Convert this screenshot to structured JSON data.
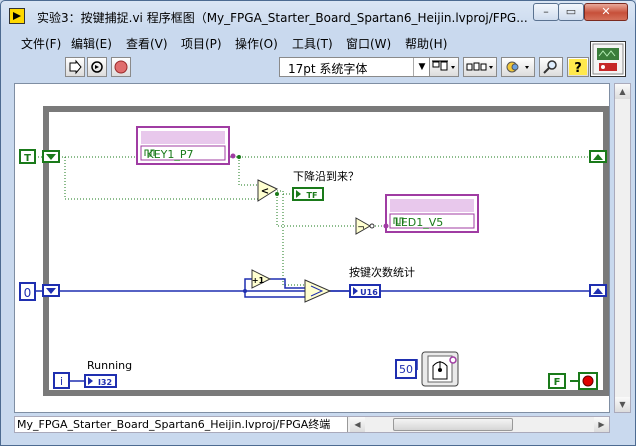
{
  "window": {
    "title": "实验3：按键捕捉.vi 程序框图（My_FPGA_Starter_Board_Spartan6_Heijin.lvproj/FPG...",
    "minimize_glyph": "–",
    "restore_glyph": "▭",
    "close_glyph": "✕"
  },
  "menu": {
    "items": [
      "文件(F)",
      "编辑(E)",
      "查看(V)",
      "项目(P)",
      "操作(O)",
      "工具(T)",
      "窗口(W)",
      "帮助(H)"
    ]
  },
  "toolbar": {
    "font_selector": "17pt 系统字体",
    "icons": [
      "run-arrow-icon",
      "run-continuously-icon",
      "abort-icon",
      "align-icon",
      "distribute-icon",
      "reorder-icon",
      "search-icon",
      "help-icon"
    ]
  },
  "diagram": {
    "terminals": {
      "left_bool": "T",
      "left_numeric": "0",
      "iteration": "i",
      "wait_ms": "50",
      "stop_bool": "F"
    },
    "io_nodes": {
      "key": "KEY1_P7",
      "led": "LED1_V5"
    },
    "indicators": {
      "falling_edge_label": "下降沿到来？",
      "falling_edge_type": "TF",
      "count_label": "按键次数统计",
      "count_type": "U16",
      "running_label": "Running",
      "running_type": "I32"
    },
    "functions": {
      "less_than": "<",
      "increment": "+1",
      "not": "¬"
    },
    "colors": {
      "bool_wire": "#1a7a1a",
      "numeric_wire": "#1f2fb0",
      "io_node": "#a03ca3",
      "loop_frame": "#7a7a7a"
    }
  },
  "statusbar": {
    "path": "My_FPGA_Starter_Board_Spartan6_Heijin.lvproj/FPGA终端"
  }
}
